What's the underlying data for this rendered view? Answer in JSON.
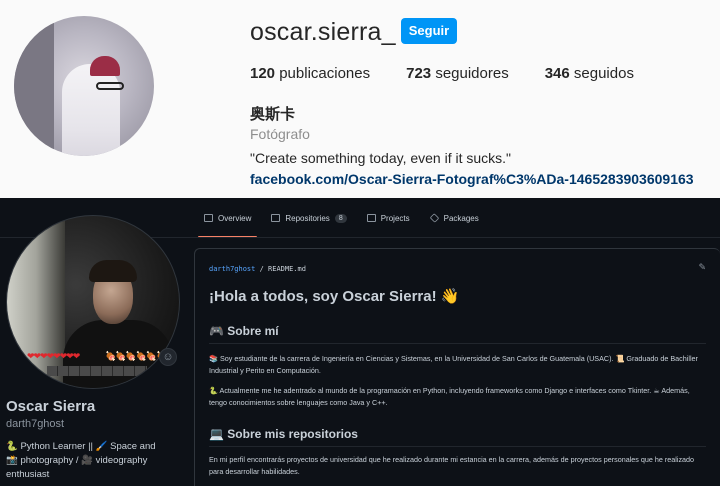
{
  "instagram": {
    "username": "oscar.sierra_",
    "follow_label": "Seguir",
    "stats": [
      {
        "count": "120",
        "label": "publicaciones"
      },
      {
        "count": "723",
        "label": "seguidores"
      },
      {
        "count": "346",
        "label": "seguidos"
      }
    ],
    "display_name": "奥斯卡",
    "category": "Fotógrafo",
    "bio": "\"Create something today, even if it sucks.\"",
    "link": "facebook.com/Oscar-Sierra-Fotograf%C3%ADa-1465283903609163",
    "accent_color": "#0095f6"
  },
  "github": {
    "tabs": [
      {
        "label": "Overview",
        "icon": "book-icon"
      },
      {
        "label": "Repositories",
        "icon": "repo-icon",
        "count": "8"
      },
      {
        "label": "Projects",
        "icon": "table-icon"
      },
      {
        "label": "Packages",
        "icon": "package-icon"
      }
    ],
    "profile": {
      "name": "Oscar Sierra",
      "login": "darth7ghost",
      "bio": "🐍 Python Learner || 🖌️ Space and 📸 photography / 🎥 videography enthusiast",
      "hud_left": "❤❤❤❤❤❤❤❤",
      "hud_right": "🍖🍖🍖🍖🍖🍖🍖"
    },
    "readme": {
      "path_owner": "darth7ghost",
      "path_sep": " / ",
      "path_file": "README.md",
      "heading": "¡Hola a todos, soy Oscar Sierra! 👋",
      "section1_title": "🎮 Sobre mí",
      "section1_p1": "📚 Soy estudiante de la carrera de Ingeniería en Ciencias y Sistemas, en la Universidad de San Carlos de Guatemala (USAC). 📜 Graduado de Bachiller Industrial y Perito en Computación.",
      "section1_p2": "🐍 Actualmente me he adentrado al mundo de la programación en Python, incluyendo frameworks como Django e interfaces como Tkinter. ☕ Además, tengo conocimientos sobre lenguajes como Java y C++.",
      "section2_title": "💻 Sobre mis repositorios",
      "section2_p1": "En mi perfil encontrarás proyectos de universidad que he realizado durante mi estancia en la carrera, además de proyectos personales que he realizado para desarrollar habilidades."
    },
    "accent_color": "#f78166",
    "link_color": "#58a6ff"
  }
}
